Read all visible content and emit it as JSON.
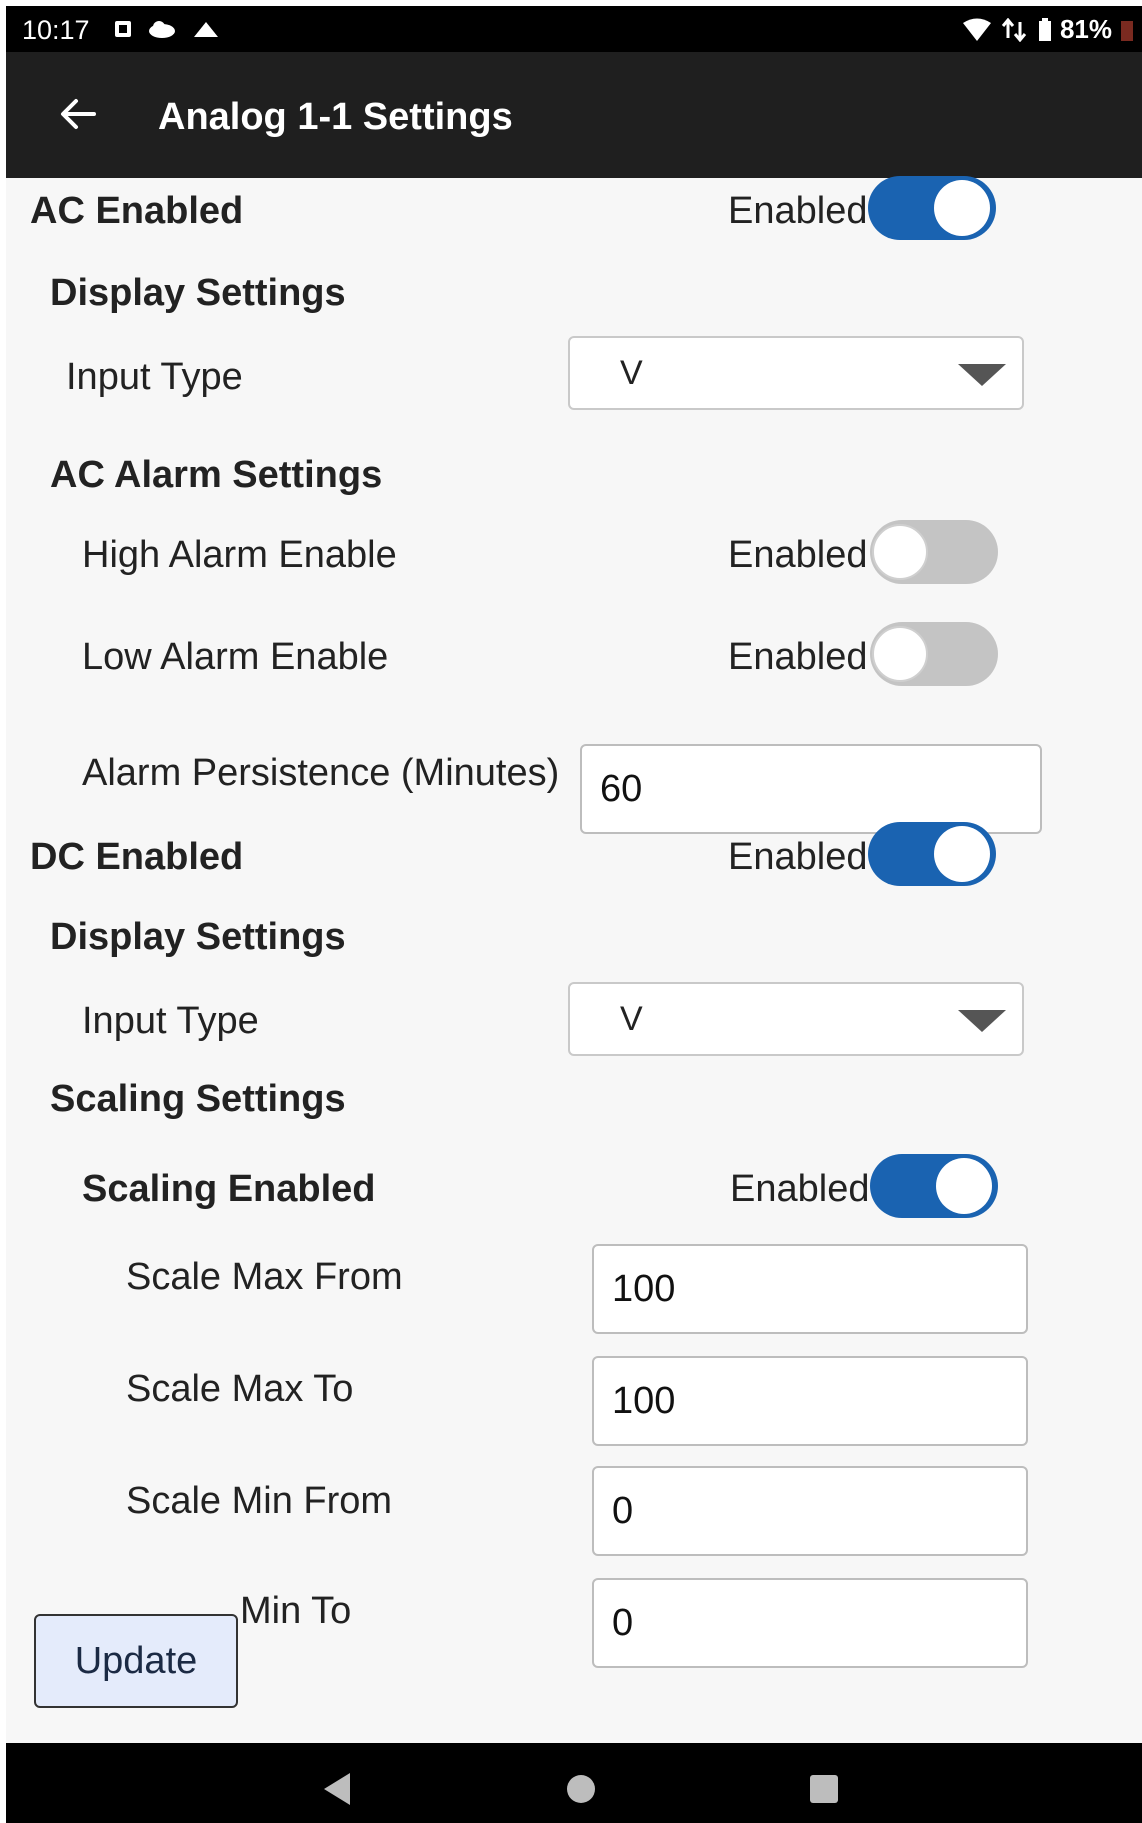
{
  "status_bar": {
    "time": "10:17",
    "battery": "81%"
  },
  "app_bar": {
    "title": "Analog 1-1 Settings"
  },
  "ac": {
    "heading": "AC Enabled",
    "toggle_label": "Enabled",
    "toggle_on": true,
    "display_heading": "Display Settings",
    "input_type_label": "Input Type",
    "input_type_value": "V",
    "alarm_heading": "AC Alarm Settings",
    "high_alarm_label": "High Alarm Enable",
    "high_alarm_toggle_label": "Enabled",
    "high_alarm_on": false,
    "low_alarm_label": "Low Alarm Enable",
    "low_alarm_toggle_label": "Enabled",
    "low_alarm_on": false,
    "persistence_label": "Alarm Persistence (Minutes)",
    "persistence_value": "60"
  },
  "dc": {
    "heading": "DC Enabled",
    "toggle_label": "Enabled",
    "toggle_on": true,
    "display_heading": "Display Settings",
    "input_type_label": "Input Type",
    "input_type_value": "V",
    "scaling_heading": "Scaling Settings",
    "scaling_enabled_label": "Scaling Enabled",
    "scaling_toggle_label": "Enabled",
    "scaling_on": true,
    "scale_max_from_label": "Scale Max From",
    "scale_max_from_value": "100",
    "scale_max_to_label": "Scale Max To",
    "scale_max_to_value": "100",
    "scale_min_from_label": "Scale Min From",
    "scale_min_from_value": "0",
    "scale_min_to_label_visible": "Min To",
    "scale_min_to_value": "0"
  },
  "update_button": "Update"
}
